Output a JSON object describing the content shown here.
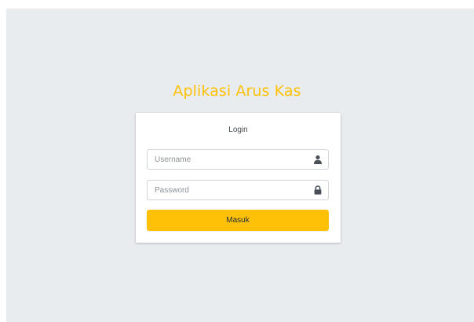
{
  "app": {
    "title": "Aplikasi Arus Kas"
  },
  "login_card": {
    "title": "Login",
    "username": {
      "value": "",
      "placeholder": "Username",
      "icon": "user-icon"
    },
    "password": {
      "value": "",
      "placeholder": "Password",
      "icon": "lock-icon"
    },
    "submit_label": "Masuk"
  },
  "colors": {
    "accent": "#ffc107",
    "page_background": "#e9ecef",
    "card_background": "#ffffff",
    "icon": "#495057"
  }
}
